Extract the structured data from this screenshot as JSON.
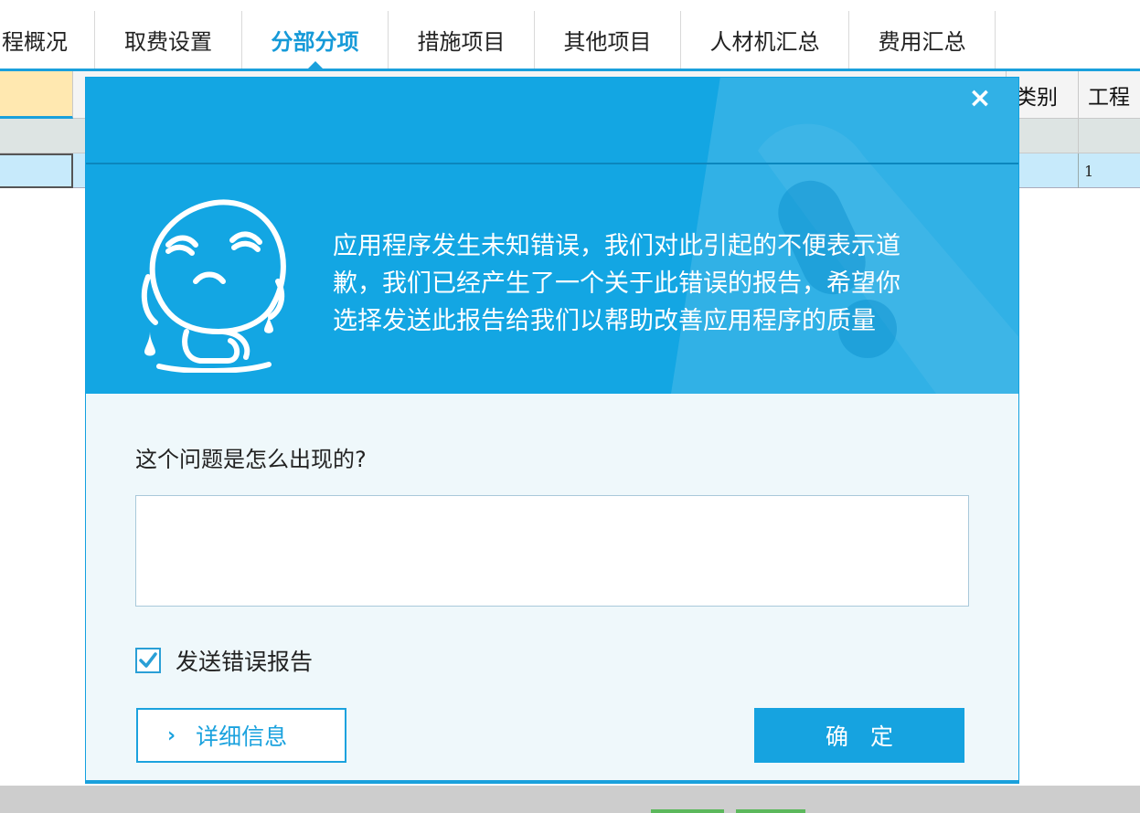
{
  "tabs": [
    {
      "label": "程概况",
      "active": false
    },
    {
      "label": "取费设置",
      "active": false
    },
    {
      "label": "分部分项",
      "active": true
    },
    {
      "label": "措施项目",
      "active": false
    },
    {
      "label": "其他项目",
      "active": false
    },
    {
      "label": "人材机汇总",
      "active": false
    },
    {
      "label": "费用汇总",
      "active": false
    }
  ],
  "grid": {
    "headers": [
      "类别",
      "工程"
    ],
    "row_value": "1"
  },
  "dialog": {
    "close_icon": "×",
    "message_lines": [
      "应用程序发生未知错误，我们对此引起的不便表示道",
      "歉，我们已经产生了一个关于此错误的报告，希望你",
      "选择发送此报告给我们以帮助改善应用程序的质量"
    ],
    "question": "这个问题是怎么出现的?",
    "description_value": "",
    "send_report": {
      "label": "发送错误报告",
      "checked": true
    },
    "details_button": {
      "chevron": "›",
      "label": "详细信息"
    },
    "ok_button": "确定"
  },
  "colors": {
    "accent": "#1aa0dc",
    "banner": "#13a6e3",
    "dialog_body": "#eff8fb"
  }
}
